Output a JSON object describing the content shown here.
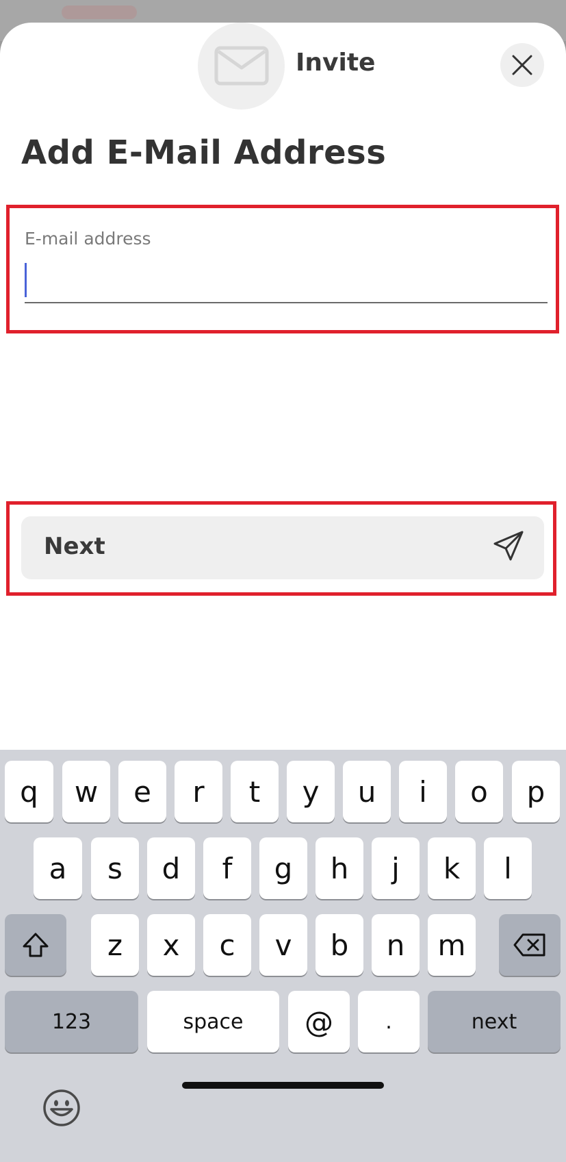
{
  "header": {
    "avatar_icon": "mail-icon",
    "title": "Invite",
    "close_icon": "close-icon"
  },
  "page_title": "Add E-Mail Address",
  "email_field": {
    "label": "E-mail address",
    "value": ""
  },
  "next_button": {
    "label": "Next",
    "icon": "send-icon"
  },
  "keyboard": {
    "row1": [
      "q",
      "w",
      "e",
      "r",
      "t",
      "y",
      "u",
      "i",
      "o",
      "p"
    ],
    "row2": [
      "a",
      "s",
      "d",
      "f",
      "g",
      "h",
      "j",
      "k",
      "l"
    ],
    "row3": [
      "z",
      "x",
      "c",
      "v",
      "b",
      "n",
      "m"
    ],
    "numbers_label": "123",
    "space_label": "space",
    "at_label": "@",
    "dot_label": ".",
    "return_label": "next",
    "shift_icon": "shift-icon",
    "delete_icon": "delete-icon",
    "emoji_icon": "emoji-icon"
  },
  "colors": {
    "highlight": "#e0202c",
    "caret": "#4a63d8"
  }
}
